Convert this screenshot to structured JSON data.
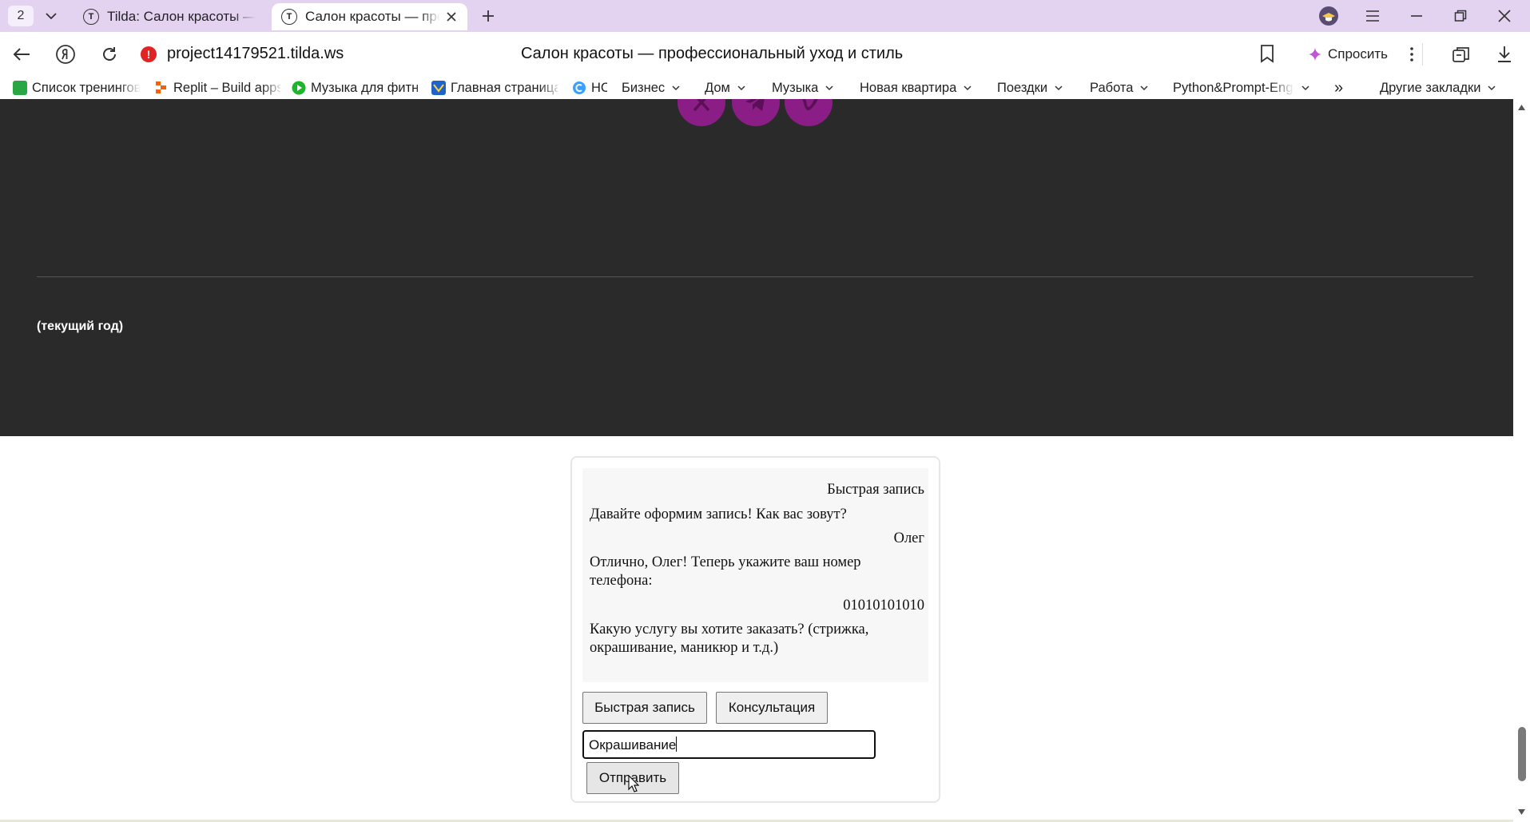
{
  "browser": {
    "tab_count": "2",
    "tabs": [
      {
        "title": "Tilda: Салон красоты — профессиональный уход и стиль",
        "active": false
      },
      {
        "title": "Салон красоты — профессиональный уход и стиль",
        "active": true
      }
    ],
    "url": "project14179521.tilda.ws",
    "page_title": "Салон красоты — профессиональный уход и стиль",
    "ask_label": "Спросить",
    "bookmarks": [
      {
        "label": "Список тренингов",
        "icon": "green-leaf-icon",
        "folder": false
      },
      {
        "label": "Replit – Build apps",
        "icon": "replit-icon",
        "folder": false
      },
      {
        "label": "Музыка для фитнеса",
        "icon": "play-icon",
        "folder": false
      },
      {
        "label": "Главная страница",
        "icon": "gosuslugi-icon",
        "folder": false
      },
      {
        "label": "НС",
        "icon": "c-icon",
        "folder": false
      },
      {
        "label": "Бизнес",
        "folder": true
      },
      {
        "label": "Дом",
        "folder": true
      },
      {
        "label": "Музыка",
        "folder": true
      },
      {
        "label": "Новая квартира",
        "folder": true
      },
      {
        "label": "Поездки",
        "folder": true
      },
      {
        "label": "Работа",
        "folder": true
      },
      {
        "label": "Python&Prompt-Engineering",
        "folder": true
      },
      {
        "label": "Другие закладки",
        "folder": true
      }
    ],
    "overflow_label": "»"
  },
  "footer": {
    "social": [
      "x-icon",
      "telegram-icon",
      "vimeo-icon"
    ],
    "year_text": "(текущий год)",
    "accent": "#8a1d86",
    "bg": "#2a2a2a"
  },
  "chat": {
    "messages": [
      {
        "side": "right",
        "text": "Быстрая запись"
      },
      {
        "side": "left",
        "text": "Давайте оформим запись! Как вас зовут?"
      },
      {
        "side": "right",
        "text": "Олег"
      },
      {
        "side": "left",
        "text": "Отлично, Олег! Теперь укажите ваш номер телефона:"
      },
      {
        "side": "right",
        "text": "01010101010"
      },
      {
        "side": "left",
        "text": "Какую услугу вы хотите заказать? (стрижка, окрашивание, маникюр и т.д.)"
      }
    ],
    "quick_buttons": [
      "Быстрая запись",
      "Консультация"
    ],
    "input_value": "Окрашивание",
    "send_label": "Отправить"
  }
}
